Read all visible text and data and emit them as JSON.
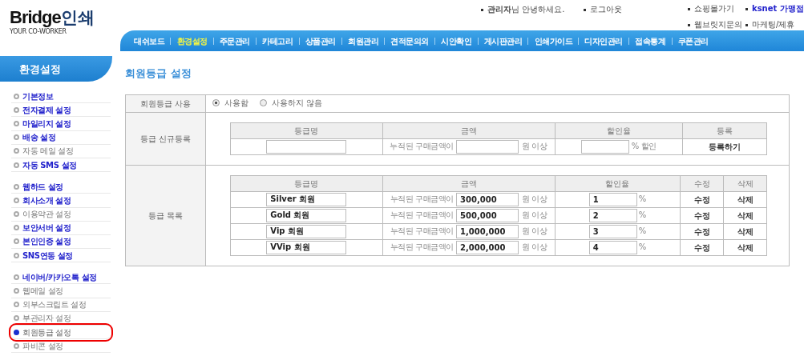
{
  "logo": {
    "name": "Bridge",
    "suffix": "인쇄",
    "tagline": "YOUR CO-WORKER"
  },
  "top_links": [
    {
      "text": "**관리자**님 안녕하세요.",
      "emphasized": false
    },
    {
      "text": "로그아웃",
      "emphasized": false
    }
  ],
  "quick_links": [
    {
      "text": "쇼핑몰가기",
      "emphasized": false
    },
    {
      "text": "ksnet 가맹점",
      "emphasized": true
    },
    {
      "text": "웹브릿지문의",
      "emphasized": false
    },
    {
      "text": "마케팅/제휴",
      "emphasized": false
    }
  ],
  "nav": [
    {
      "label": "대쉬보드",
      "selected": false
    },
    {
      "label": "환경설정",
      "selected": true
    },
    {
      "label": "주문관리",
      "selected": false
    },
    {
      "label": "카테고리",
      "selected": false
    },
    {
      "label": "상품관리",
      "selected": false
    },
    {
      "label": "회원관리",
      "selected": false
    },
    {
      "label": "견적문의외",
      "selected": false
    },
    {
      "label": "시안확인",
      "selected": false
    },
    {
      "label": "게시판관리",
      "selected": false
    },
    {
      "label": "인쇄가이드",
      "selected": false
    },
    {
      "label": "디자인관리",
      "selected": false
    },
    {
      "label": "접속통계",
      "selected": false
    },
    {
      "label": "쿠폰관리",
      "selected": false
    }
  ],
  "sidebar": {
    "title": "환경설정",
    "groups": [
      [
        {
          "label": "기본정보",
          "emphasized": true,
          "selected": false
        },
        {
          "label": "전자결제 설정",
          "emphasized": true,
          "selected": false
        },
        {
          "label": "마일리지 설정",
          "emphasized": true,
          "selected": false
        },
        {
          "label": "배송 설정",
          "emphasized": true,
          "selected": false
        },
        {
          "label": "자동 메일 설정",
          "emphasized": false,
          "selected": false
        },
        {
          "label": "자동 SMS 설정",
          "emphasized": true,
          "selected": false
        }
      ],
      [
        {
          "label": "웹하드 설정",
          "emphasized": true,
          "selected": false
        },
        {
          "label": "회사소개 설정",
          "emphasized": true,
          "selected": false
        },
        {
          "label": "이용약관 설정",
          "emphasized": false,
          "selected": false
        },
        {
          "label": "보안서버 설정",
          "emphasized": true,
          "selected": false
        },
        {
          "label": "본인인증 설정",
          "emphasized": true,
          "selected": false
        },
        {
          "label": "SNS연동 설정",
          "emphasized": true,
          "selected": false
        }
      ],
      [
        {
          "label": "네이버/카카오톡 설정",
          "emphasized": true,
          "selected": false
        },
        {
          "label": "웹메일 설정",
          "emphasized": false,
          "selected": false
        },
        {
          "label": "외부스크립트 설정",
          "emphasized": false,
          "selected": false
        },
        {
          "label": "부관리자 설정",
          "emphasized": false,
          "selected": false
        },
        {
          "label": "회원등급 설정",
          "emphasized": false,
          "selected": true
        },
        {
          "label": "파비콘 설정",
          "emphasized": false,
          "selected": false
        }
      ]
    ]
  },
  "page_title": "회원등급 설정",
  "use_grade": {
    "label": "회원등급 사용",
    "options": [
      {
        "label": "사용함",
        "selected": true
      },
      {
        "label": "사용하지 않음",
        "selected": false
      }
    ]
  },
  "new_grade": {
    "label": "등급 신규등록",
    "columns": [
      "등급명",
      "금액",
      "할인율",
      "등록"
    ],
    "amount_prefix": "누적된 구매금액이",
    "amount_suffix": "원 이상",
    "rate_suffix": "% 할인",
    "action": "등록하기"
  },
  "grade_list": {
    "label": "등급 목록",
    "columns": [
      "등급명",
      "금액",
      "할인율",
      "수정",
      "삭제"
    ],
    "rows": [
      {
        "name": "Silver 회원",
        "amount_prefix": "누적된 구매금액이",
        "amount": "300,000",
        "amount_suffix": "원 이상",
        "rate": "1",
        "rate_suffix": "%",
        "edit": "수정",
        "delete": "삭제"
      },
      {
        "name": "Gold 회원",
        "amount_prefix": "누적된 구매금액이",
        "amount": "500,000",
        "amount_suffix": "원 이상",
        "rate": "2",
        "rate_suffix": "%",
        "edit": "수정",
        "delete": "삭제"
      },
      {
        "name": "Vip 회원",
        "amount_prefix": "누적된 구매금액이",
        "amount": "1,000,000",
        "amount_suffix": "원 이상",
        "rate": "3",
        "rate_suffix": "%",
        "edit": "수정",
        "delete": "삭제"
      },
      {
        "name": "VVip 회원",
        "amount_prefix": "누적된 구매금액이",
        "amount": "2,000,000",
        "amount_suffix": "원 이상",
        "rate": "4",
        "rate_suffix": "%",
        "edit": "수정",
        "delete": "삭제"
      }
    ]
  }
}
